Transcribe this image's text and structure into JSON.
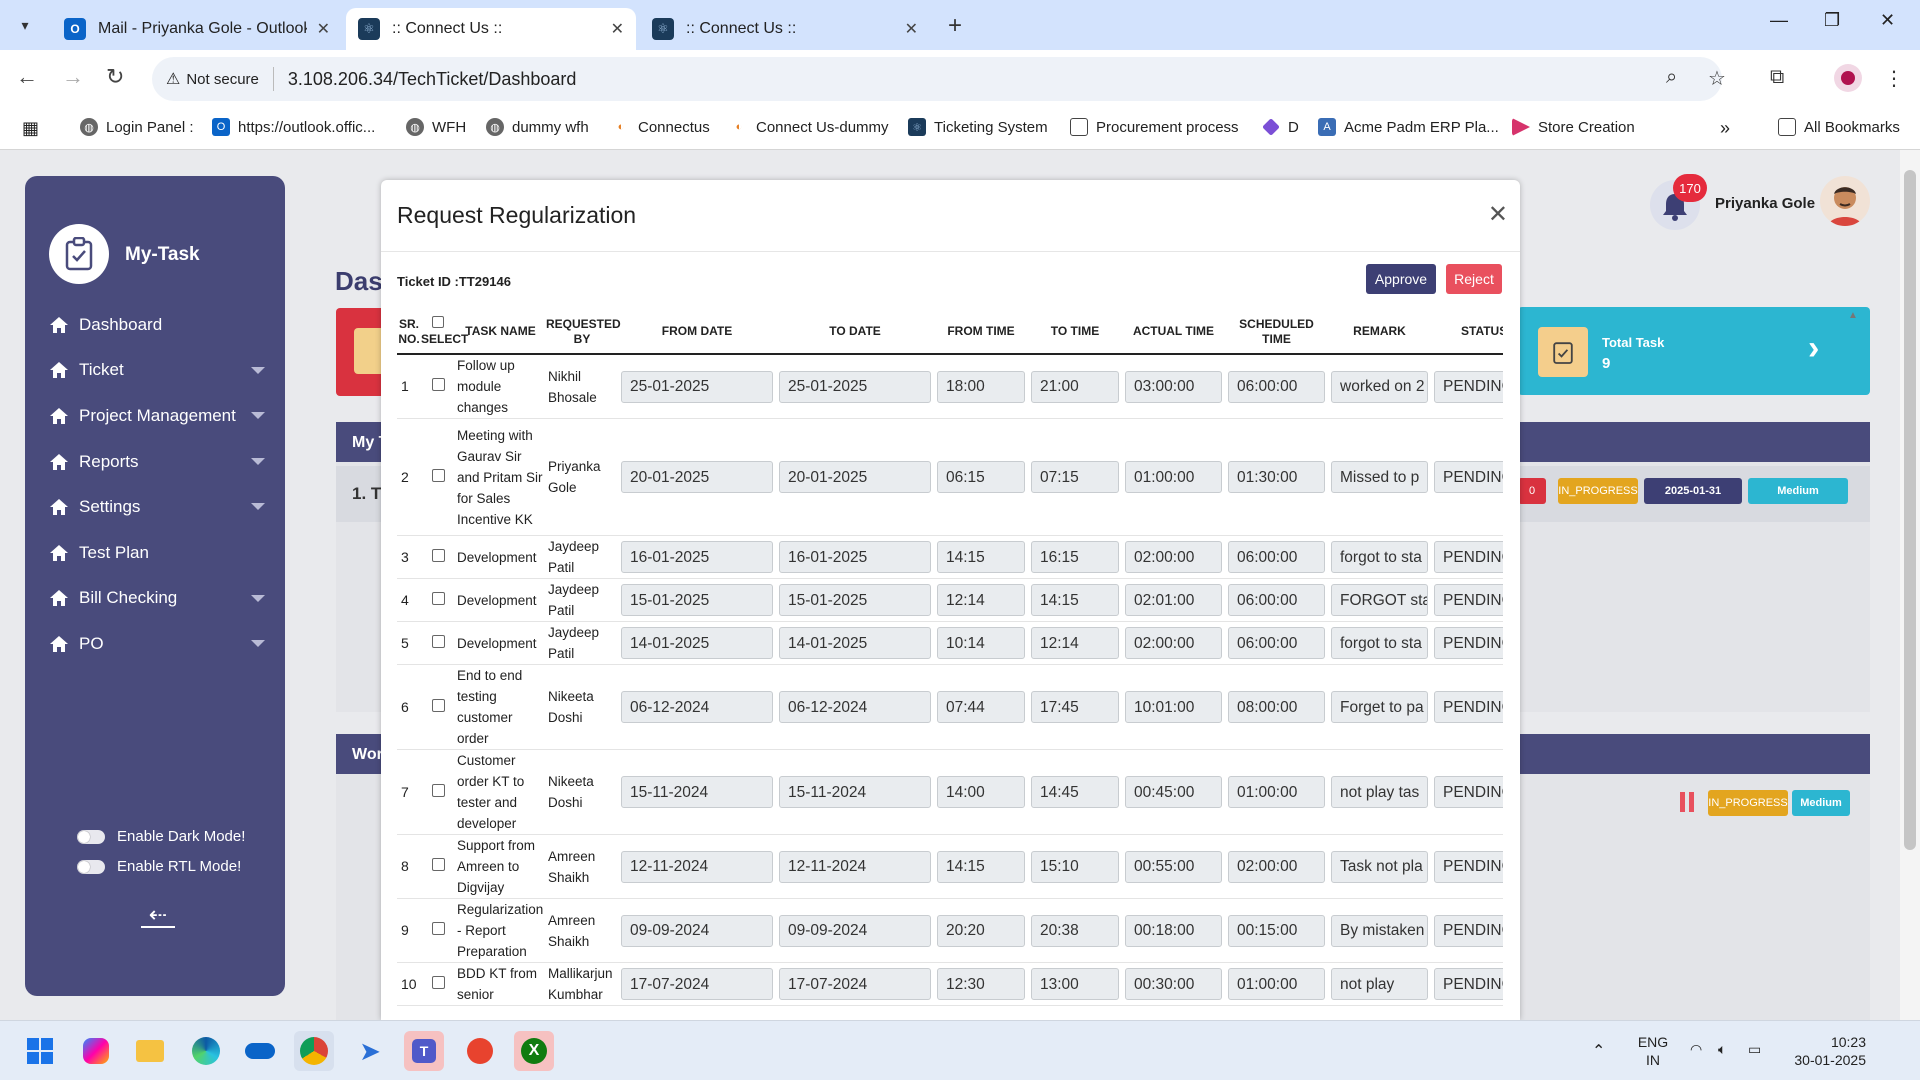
{
  "browser": {
    "tabs": [
      {
        "title": "Mail - Priyanka Gole - Outlook",
        "active": false
      },
      {
        "title": ":: Connect Us ::",
        "active": true
      },
      {
        "title": ":: Connect Us ::",
        "active": false
      }
    ],
    "address": {
      "security": "Not secure",
      "url": "3.108.206.34/TechTicket/Dashboard"
    },
    "bookmarks": [
      "Login Panel :",
      "https://outlook.offic...",
      "WFH",
      "dummy wfh",
      "Connectus",
      "Connect Us-dummy",
      "Ticketing System",
      "Procurement process",
      "D",
      "Acme Padm ERP Pla...",
      "Store Creation"
    ],
    "all_bookmarks": "All Bookmarks"
  },
  "sidebar": {
    "brand": "My-Task",
    "items": [
      {
        "label": "Dashboard",
        "caret": false
      },
      {
        "label": "Ticket",
        "caret": true
      },
      {
        "label": "Project Management",
        "caret": true
      },
      {
        "label": "Reports",
        "caret": true
      },
      {
        "label": "Settings",
        "caret": true
      },
      {
        "label": "Test Plan",
        "caret": false
      },
      {
        "label": "Bill Checking",
        "caret": true
      },
      {
        "label": "PO",
        "caret": true
      }
    ],
    "dark_mode": "Enable Dark Mode!",
    "rtl_mode": "Enable RTL Mode!"
  },
  "header": {
    "notifications": "170",
    "user_name": "Priyanka Gole"
  },
  "background": {
    "dash_title": "Das",
    "total_task_label": "Total Task",
    "total_task_value": "9",
    "panel1_title": "My T",
    "panel1_row": "1. T",
    "panel2_title": "Wor",
    "chips_row1": [
      "0",
      "IN_PROGRESS",
      "2025-01-31",
      "Medium"
    ],
    "chips_row2": [
      "IN_PROGRESS",
      "Medium"
    ]
  },
  "modal": {
    "title": "Request Regularization",
    "ticket_id": "Ticket ID :TT29146",
    "approve": "Approve",
    "reject": "Reject",
    "columns": [
      "SR. NO.",
      "SELECT",
      "TASK NAME",
      "REQUESTED BY",
      "FROM DATE",
      "TO DATE",
      "FROM TIME",
      "TO TIME",
      "ACTUAL TIME",
      "SCHEDULED TIME",
      "REMARK",
      "STATUS"
    ],
    "rows": [
      {
        "sr": "1",
        "task": "Follow up module changes",
        "by": "Nikhil Bhosale",
        "from_date": "25-01-2025",
        "to_date": "25-01-2025",
        "from_time": "18:00",
        "to_time": "21:00",
        "actual": "03:00:00",
        "scheduled": "06:00:00",
        "remark": "worked on 2",
        "status": "PENDING"
      },
      {
        "sr": "2",
        "task": "Meeting with Gaurav Sir and Pritam Sir for Sales Incentive KK",
        "by": "Priyanka Gole",
        "from_date": "20-01-2025",
        "to_date": "20-01-2025",
        "from_time": "06:15",
        "to_time": "07:15",
        "actual": "01:00:00",
        "scheduled": "01:30:00",
        "remark": "Missed to p",
        "status": "PENDING"
      },
      {
        "sr": "3",
        "task": "Development",
        "by": "Jaydeep Patil",
        "from_date": "16-01-2025",
        "to_date": "16-01-2025",
        "from_time": "14:15",
        "to_time": "16:15",
        "actual": "02:00:00",
        "scheduled": "06:00:00",
        "remark": "forgot to sta",
        "status": "PENDING"
      },
      {
        "sr": "4",
        "task": "Development",
        "by": "Jaydeep Patil",
        "from_date": "15-01-2025",
        "to_date": "15-01-2025",
        "from_time": "12:14",
        "to_time": "14:15",
        "actual": "02:01:00",
        "scheduled": "06:00:00",
        "remark": "FORGOT sta",
        "status": "PENDING"
      },
      {
        "sr": "5",
        "task": "Development",
        "by": "Jaydeep Patil",
        "from_date": "14-01-2025",
        "to_date": "14-01-2025",
        "from_time": "10:14",
        "to_time": "12:14",
        "actual": "02:00:00",
        "scheduled": "06:00:00",
        "remark": "forgot to sta",
        "status": "PENDING"
      },
      {
        "sr": "6",
        "task": "End to end testing customer order",
        "by": "Nikeeta Doshi",
        "from_date": "06-12-2024",
        "to_date": "06-12-2024",
        "from_time": "07:44",
        "to_time": "17:45",
        "actual": "10:01:00",
        "scheduled": "08:00:00",
        "remark": "Forget to pa",
        "status": "PENDING"
      },
      {
        "sr": "7",
        "task": "Customer order KT to tester and developer",
        "by": "Nikeeta Doshi",
        "from_date": "15-11-2024",
        "to_date": "15-11-2024",
        "from_time": "14:00",
        "to_time": "14:45",
        "actual": "00:45:00",
        "scheduled": "01:00:00",
        "remark": "not play tas",
        "status": "PENDING"
      },
      {
        "sr": "8",
        "task": "Support from Amreen to Digvijay",
        "by": "Amreen Shaikh",
        "from_date": "12-11-2024",
        "to_date": "12-11-2024",
        "from_time": "14:15",
        "to_time": "15:10",
        "actual": "00:55:00",
        "scheduled": "02:00:00",
        "remark": "Task not pla",
        "status": "PENDING"
      },
      {
        "sr": "9",
        "task": "Regularization - Report Preparation",
        "by": "Amreen Shaikh",
        "from_date": "09-09-2024",
        "to_date": "09-09-2024",
        "from_time": "20:20",
        "to_time": "20:38",
        "actual": "00:18:00",
        "scheduled": "00:15:00",
        "remark": "By mistaken",
        "status": "PENDING"
      },
      {
        "sr": "10",
        "task": "BDD KT from senior",
        "by": "Mallikarjun Kumbhar",
        "from_date": "17-07-2024",
        "to_date": "17-07-2024",
        "from_time": "12:30",
        "to_time": "13:00",
        "actual": "00:30:00",
        "scheduled": "01:00:00",
        "remark": "not play",
        "status": "PENDING"
      }
    ]
  },
  "taskbar": {
    "lang": "ENG",
    "region": "IN",
    "time": "10:23",
    "date": "30-01-2025"
  }
}
